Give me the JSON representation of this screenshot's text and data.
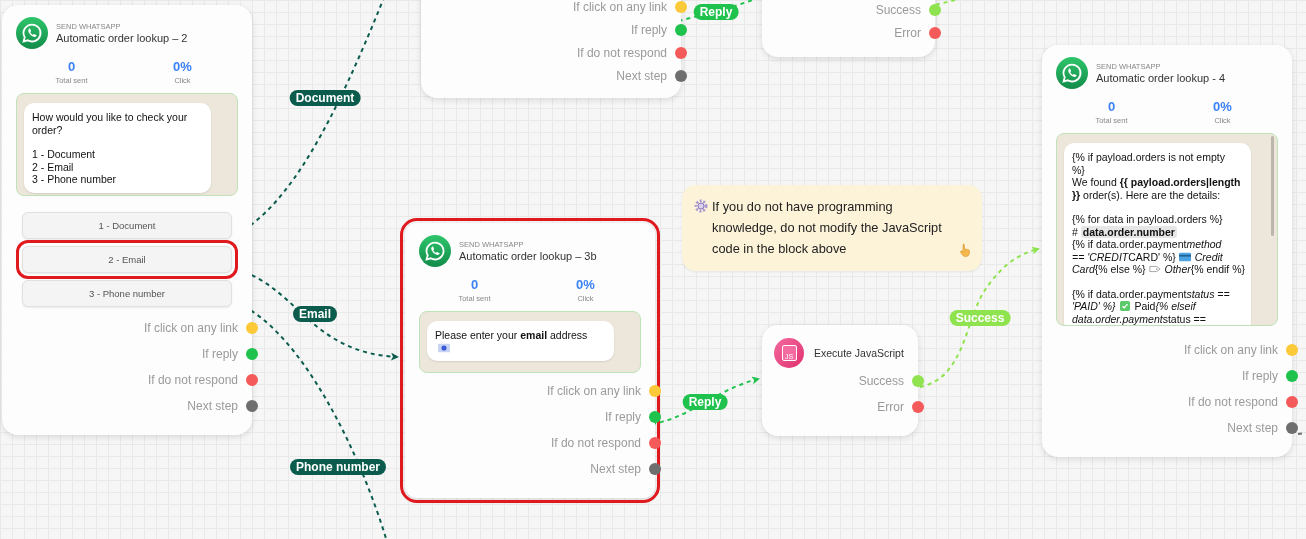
{
  "nodes": [
    {
      "kind": "whatsapp",
      "type_label": "SEND WHATSAPP",
      "title": "Automatic order lookup – 2",
      "selected": false,
      "stats": [
        {
          "value": "0",
          "label": "Total sent"
        },
        {
          "value": "0%",
          "label": "Click"
        }
      ],
      "message": [
        [
          [
            {
              "text": "How would you like to check your"
            }
          ],
          [
            {
              "text": "order?"
            }
          ]
        ],
        [
          [
            {
              "text": "1 - Document"
            }
          ],
          [
            {
              "text": "2 - Email"
            }
          ],
          [
            {
              "text": "3 - Phone number"
            }
          ]
        ]
      ],
      "options": [
        {
          "label": "1 - Document",
          "selected": false
        },
        {
          "label": "2 - Email",
          "selected": true
        },
        {
          "label": "3 - Phone number",
          "selected": false
        }
      ],
      "outputs": [
        {
          "label": "If click on any link",
          "color": "#fcc938"
        },
        {
          "label": "If reply",
          "color": "#1fc24d"
        },
        {
          "label": "If do not respond",
          "color": "#f55a5a"
        },
        {
          "label": "Next step",
          "color": "#6e6e6e"
        }
      ]
    },
    {
      "kind": "outputs",
      "outputs": [
        {
          "label": "If click on any link",
          "color": "#fcc938"
        },
        {
          "label": "If reply",
          "color": "#1fc24d"
        },
        {
          "label": "If do not respond",
          "color": "#f55a5a"
        },
        {
          "label": "Next step",
          "color": "#6e6e6e"
        }
      ]
    },
    {
      "kind": "outputs",
      "outputs": [
        {
          "label": "Success",
          "color": "#8fe34f"
        },
        {
          "label": "Error",
          "color": "#f55a5a"
        }
      ]
    },
    {
      "kind": "whatsapp",
      "type_label": "SEND WHATSAPP",
      "title": "Automatic order lookup – 3b",
      "selected": true,
      "stats": [
        {
          "value": "0",
          "label": "Total sent"
        },
        {
          "value": "0%",
          "label": "Click"
        }
      ],
      "message": [
        [
          [
            {
              "text": "Please enter your **email** address"
            }
          ],
          [
            {
              "kind": "mail"
            }
          ]
        ]
      ],
      "outputs": [
        {
          "label": "If click on any link",
          "color": "#fcc938"
        },
        {
          "label": "If reply",
          "color": "#1fc24d"
        },
        {
          "label": "If do not respond",
          "color": "#f55a5a"
        },
        {
          "label": "Next step",
          "color": "#6e6e6e"
        }
      ]
    },
    {
      "kind": "javascript",
      "icon_text": "JS",
      "title": "Execute JavaScript",
      "outputs": [
        {
          "label": "Success",
          "color": "#8fe34f"
        },
        {
          "label": "Error",
          "color": "#f55a5a"
        }
      ]
    },
    {
      "kind": "whatsapp",
      "type_label": "SEND WHATSAPP",
      "title": "Automatic order lookup - 4",
      "selected": false,
      "stats": [
        {
          "value": "0",
          "label": "Total sent"
        },
        {
          "value": "0%",
          "label": "Click"
        }
      ],
      "message": [
        [
          [
            {
              "text": "{% if payload.orders is not empty"
            }
          ],
          [
            {
              "text": "%}"
            }
          ],
          [
            {
              "text": "We found **{{ payload.orders|length**"
            }
          ],
          [
            {
              "text": "**}}** order(s). Here are the details:"
            }
          ]
        ],
        [
          [
            {
              "text": "{% for data in payload.orders %}"
            }
          ],
          [
            {
              "text": "# "
            },
            {
              "kind": "chip",
              "text": "data.order.number"
            }
          ],
          [
            {
              "text": "{% if data.order.payment"
            },
            {
              "text": "*method*"
            }
          ],
          [
            {
              "text": "*== 'CREDIT*"
            },
            {
              "text": "CARD' %}"
            },
            {
              "kind": "card"
            },
            {
              "text": " *Credit*"
            }
          ],
          [
            {
              "text": "*Card*{% else %}"
            },
            {
              "kind": "tag"
            },
            {
              "text": " *Other*{% endif %}"
            }
          ]
        ],
        [
          [
            {
              "text": "{% if data.order.payment"
            },
            {
              "text": "*status ==*"
            }
          ],
          [
            {
              "text": "*'PAID' %}*"
            },
            {
              "kind": "check"
            },
            {
              "text": " Paid"
            },
            {
              "text": "*{% elseif*"
            }
          ],
          [
            {
              "text": "*data.order.payment*"
            },
            {
              "text": "status =="
            }
          ]
        ]
      ],
      "outputs": [
        {
          "label": "If click on any link",
          "color": "#fcc938"
        },
        {
          "label": "If reply",
          "color": "#1fc24d"
        },
        {
          "label": "If do not respond",
          "color": "#f55a5a"
        },
        {
          "label": "Next step",
          "color": "#6e6e6e"
        }
      ]
    }
  ],
  "note": {
    "text": "If you do not have programming knowledge, do not modify the JavaScript code in the block above"
  },
  "edges": [
    {
      "label": "Document",
      "color": "#0b5c4d"
    },
    {
      "label": "Email",
      "color": "#0b5c4d"
    },
    {
      "label": "Phone number",
      "color": "#0b5c4d"
    },
    {
      "label": "Reply",
      "color": "#1fc24d"
    },
    {
      "label": "Reply",
      "color": "#1fc24d"
    },
    {
      "label": "Success",
      "color": "#8fe34f"
    },
    {
      "color": "#8fe34f"
    },
    {
      "color": "#6e6e6e"
    }
  ]
}
